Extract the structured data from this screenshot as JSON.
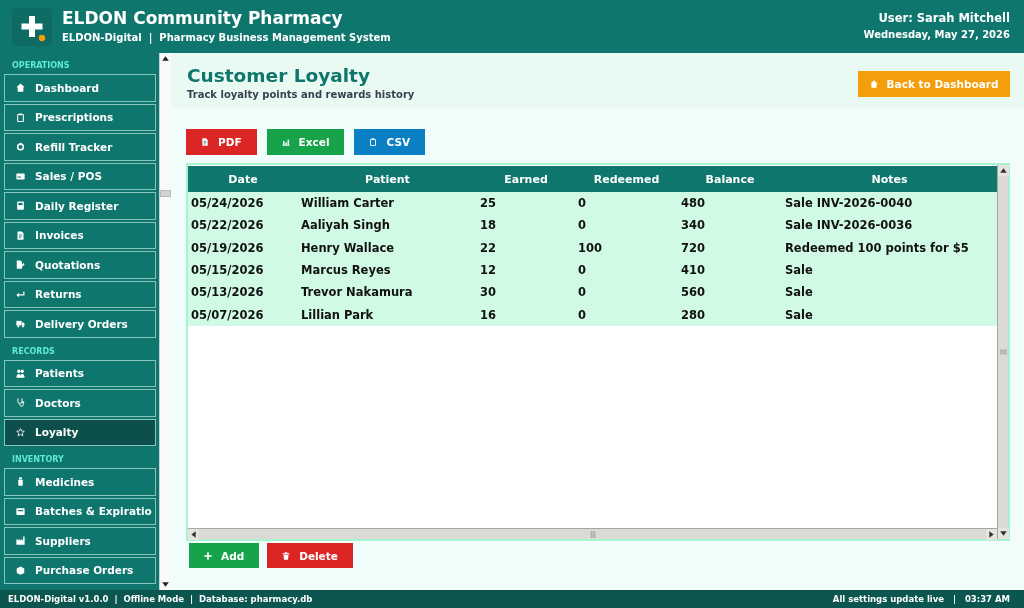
{
  "header": {
    "title": "ELDON Community Pharmacy",
    "subtitle": "ELDON-Digital  |  Pharmacy Business Management System",
    "user": "User: Sarah Mitchell",
    "date": "Wednesday, May 27, 2026"
  },
  "sidebar": {
    "sections": [
      {
        "label": "OPERATIONS",
        "items": [
          {
            "label": "Dashboard",
            "selected": false
          },
          {
            "label": "Prescriptions",
            "selected": false
          },
          {
            "label": "Refill Tracker",
            "selected": false
          },
          {
            "label": "Sales / POS",
            "selected": false
          },
          {
            "label": "Daily Register",
            "selected": false
          },
          {
            "label": "Invoices",
            "selected": false
          },
          {
            "label": "Quotations",
            "selected": false
          },
          {
            "label": "Returns",
            "selected": false
          },
          {
            "label": "Delivery Orders",
            "selected": false
          }
        ]
      },
      {
        "label": "RECORDS",
        "items": [
          {
            "label": "Patients",
            "selected": false
          },
          {
            "label": "Doctors",
            "selected": false
          },
          {
            "label": "Loyalty",
            "selected": true
          }
        ]
      },
      {
        "label": "INVENTORY",
        "items": [
          {
            "label": "Medicines",
            "selected": false
          },
          {
            "label": "Batches & Expiratio",
            "selected": false
          },
          {
            "label": "Suppliers",
            "selected": false
          },
          {
            "label": "Purchase Orders",
            "selected": false
          }
        ]
      }
    ]
  },
  "page": {
    "title": "Customer Loyalty",
    "subtitle": "Track loyalty points and rewards history",
    "back_button": "Back to Dashboard"
  },
  "export_buttons": [
    {
      "label": "PDF",
      "kind": "pdf"
    },
    {
      "label": "Excel",
      "kind": "excel"
    },
    {
      "label": "CSV",
      "kind": "csv"
    }
  ],
  "table": {
    "columns": [
      "Date",
      "Patient",
      "Earned",
      "Redeemed",
      "Balance",
      "Notes"
    ],
    "rows": [
      [
        "05/24/2026",
        "William Carter",
        "25",
        "0",
        "480",
        "Sale INV-2026-0040"
      ],
      [
        "05/22/2026",
        "Aaliyah Singh",
        "18",
        "0",
        "340",
        "Sale INV-2026-0036"
      ],
      [
        "05/19/2026",
        "Henry Wallace",
        "22",
        "100",
        "720",
        "Redeemed 100 points for $5"
      ],
      [
        "05/15/2026",
        "Marcus Reyes",
        "12",
        "0",
        "410",
        "Sale"
      ],
      [
        "05/13/2026",
        "Trevor Nakamura",
        "30",
        "0",
        "560",
        "Sale"
      ],
      [
        "05/07/2026",
        "Lillian Park",
        "16",
        "0",
        "280",
        "Sale"
      ]
    ]
  },
  "actions": [
    {
      "label": "Add",
      "kind": "add"
    },
    {
      "label": "Delete",
      "kind": "delete"
    }
  ],
  "status_bar": {
    "left": "ELDON-Digital v1.0.0  |  Offline Mode  |  Database: pharmacy.db",
    "right": "All settings update live   |   03:37 AM"
  }
}
